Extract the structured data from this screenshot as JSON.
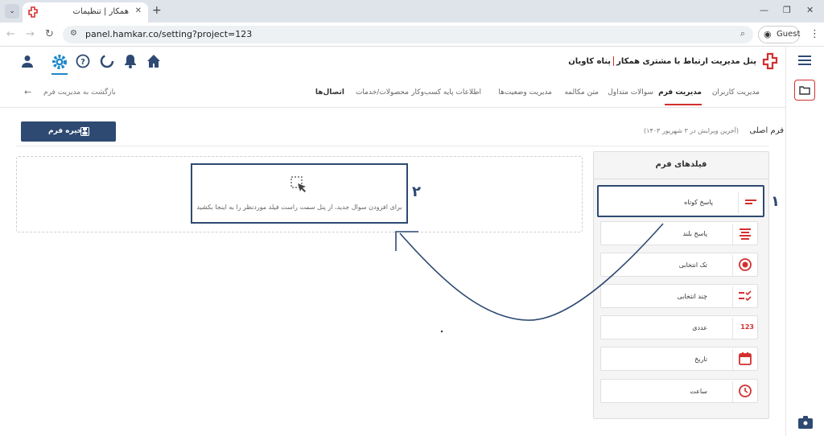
{
  "browser": {
    "tab_title": "همکار | تنظیمات",
    "url": "panel.hamkar.co/setting?project=123",
    "guest_label": "Guest"
  },
  "header": {
    "brand_company": "پناه کاویان",
    "brand_title": "پنل مدیریت ارتباط با مشتری همکار"
  },
  "subnav": {
    "tabs": [
      {
        "label": "مدیریت کاربران"
      },
      {
        "label": "مدیریت فرم"
      },
      {
        "label": "سوالات متداول"
      },
      {
        "label": "متن مکالمه"
      },
      {
        "label": "مدیریت وضعیت‌ها"
      },
      {
        "label": "اطلاعات پایه کسب‌وکار"
      },
      {
        "label": "محصولات/خدمات"
      },
      {
        "label": "اتصال‌ها"
      }
    ],
    "active_tab": "مدیریت فرم",
    "back_label": "بازگشت به مدیریت فرم"
  },
  "form": {
    "save_label": "ذخیره فرم",
    "title": "فرم اصلی",
    "last_edit": "(آخرین ویرایش در ۳ شهریور ۱۴۰۳)",
    "dropzone_hint": "برای افزودن سوال جدید، از پنل سمت راست فیلد موردنظر را به اینجا بکشید"
  },
  "fields_panel": {
    "title": "فیلدهای فرم",
    "items": [
      {
        "label": "پاسخ کوتاه",
        "icon": "short-answer-icon"
      },
      {
        "label": "پاسخ بلند",
        "icon": "long-answer-icon"
      },
      {
        "label": "تک انتخابی",
        "icon": "radio-icon"
      },
      {
        "label": "چند انتخابی",
        "icon": "checklist-icon"
      },
      {
        "label": "عددی",
        "icon": "number-icon",
        "glyph": "123"
      },
      {
        "label": "تاریخ",
        "icon": "calendar-icon"
      },
      {
        "label": "ساعت",
        "icon": "clock-icon"
      }
    ]
  },
  "annotations": {
    "step1": "۱",
    "step2": "۲"
  },
  "colors": {
    "accent": "#d32f2f",
    "primary": "#2e4a72"
  }
}
